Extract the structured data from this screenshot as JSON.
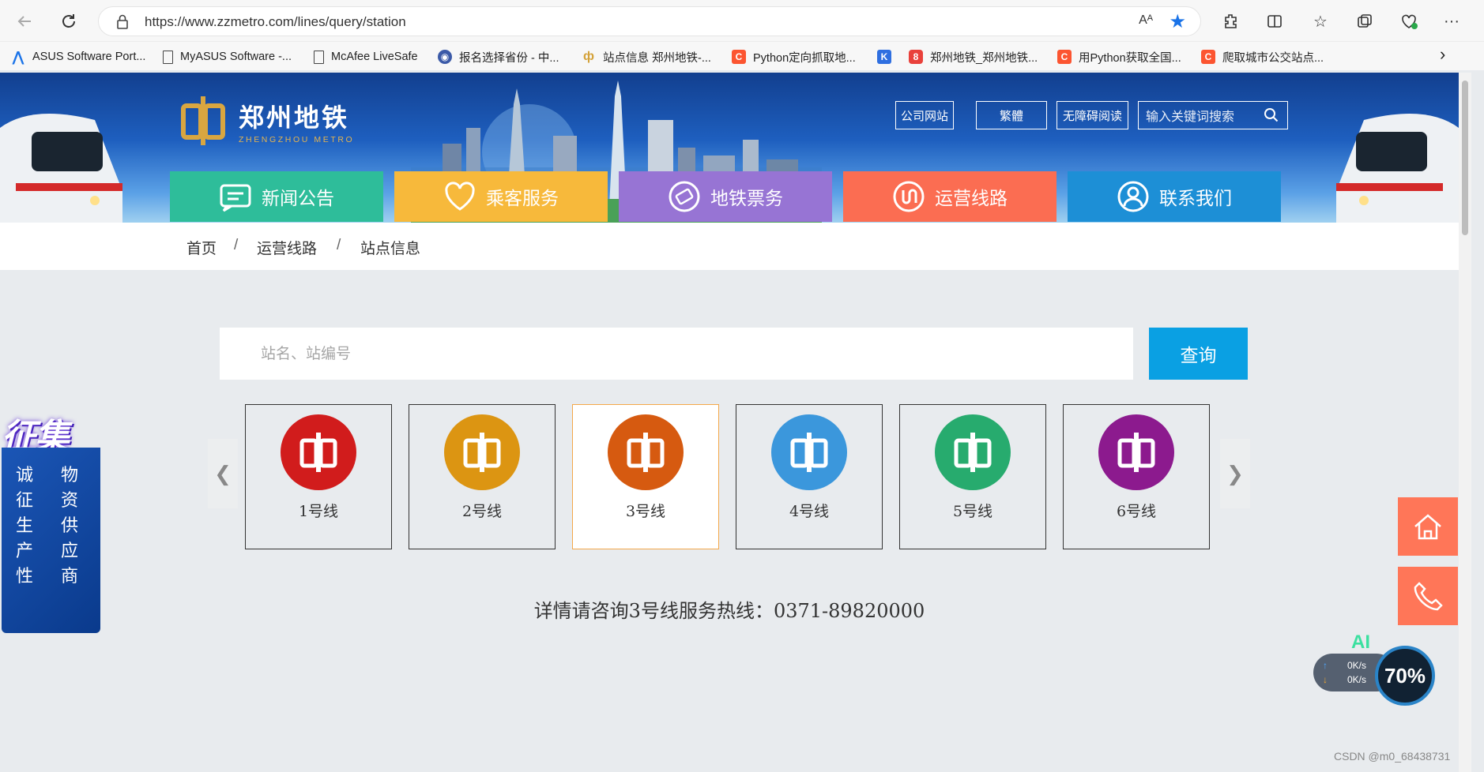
{
  "browser": {
    "url": "https://www.zzmetro.com/lines/query/station",
    "read_aloud": "Aᴬ",
    "bookmarks": [
      {
        "label": "ASUS Software Port...",
        "icon": "asus-icon",
        "color": "#1a73e8"
      },
      {
        "label": "MyASUS Software -...",
        "icon": "page-icon",
        "color": "#444444"
      },
      {
        "label": "McAfee LiveSafe",
        "icon": "page-icon",
        "color": "#444444"
      },
      {
        "label": "报名选择省份 - 中...",
        "icon": "globe-icon",
        "color": "#3b5aa8"
      },
      {
        "label": "站点信息 郑州地铁-...",
        "icon": "metro-logo-icon",
        "color": "#d4a23a"
      },
      {
        "label": "Python定向抓取地...",
        "icon": "csdn-icon",
        "color": "#fc5531"
      },
      {
        "label": "",
        "icon": "shield-icon",
        "color": "#2f6fe0"
      },
      {
        "label": "郑州地铁_郑州地铁...",
        "icon": "baidu-icon",
        "color": "#e9413b"
      },
      {
        "label": "用Python获取全国...",
        "icon": "csdn-icon",
        "color": "#fc5531"
      },
      {
        "label": "爬取城市公交站点...",
        "icon": "csdn-icon",
        "color": "#fc5531"
      }
    ],
    "more_bookmarks": "›"
  },
  "header": {
    "logo_cn": "郑州地铁",
    "logo_en": "ZHENGZHOU METRO",
    "buttons": [
      "公司网站",
      "繁體",
      "无障碍阅读"
    ],
    "search_placeholder": "输入关键词搜索"
  },
  "menu": [
    {
      "label": "新闻公告",
      "icon": "message-icon",
      "color": "#2ebd9a"
    },
    {
      "label": "乘客服务",
      "icon": "heart-icon",
      "color": "#f7b93b"
    },
    {
      "label": "地铁票务",
      "icon": "ticket-icon",
      "color": "#9774d4"
    },
    {
      "label": "运营线路",
      "icon": "route-icon",
      "color": "#fb6d52"
    },
    {
      "label": "联系我们",
      "icon": "user-icon",
      "color": "#1d8fd6"
    }
  ],
  "breadcrumb": [
    "首页",
    "运营线路",
    "站点信息"
  ],
  "breadcrumb_sep": "/",
  "station_search": {
    "placeholder": "站名、站编号",
    "button": "查询"
  },
  "carousel": {
    "prev": "❮",
    "next": "❯",
    "lines": [
      {
        "label": "1号线",
        "color": "#d11c1c",
        "active": false
      },
      {
        "label": "2号线",
        "color": "#dc9512",
        "active": false
      },
      {
        "label": "3号线",
        "color": "#d65a10",
        "active": true
      },
      {
        "label": "4号线",
        "color": "#3b97dc",
        "active": false
      },
      {
        "label": "5号线",
        "color": "#27ab6e",
        "active": false
      },
      {
        "label": "6号线",
        "color": "#8c1a8e",
        "active": false
      }
    ]
  },
  "hotline": "详情请咨询3号线服务热线：0371-89820000",
  "recruit": {
    "title": "征集",
    "col1": [
      "诚",
      "征",
      "生",
      "产",
      "性"
    ],
    "col2": [
      "物",
      "资",
      "供",
      "应",
      "商"
    ]
  },
  "netmon": {
    "ai": "AI",
    "up": "0K/s",
    "down": "0K/s",
    "percent": "70%"
  },
  "watermark": "CSDN @m0_68438731"
}
